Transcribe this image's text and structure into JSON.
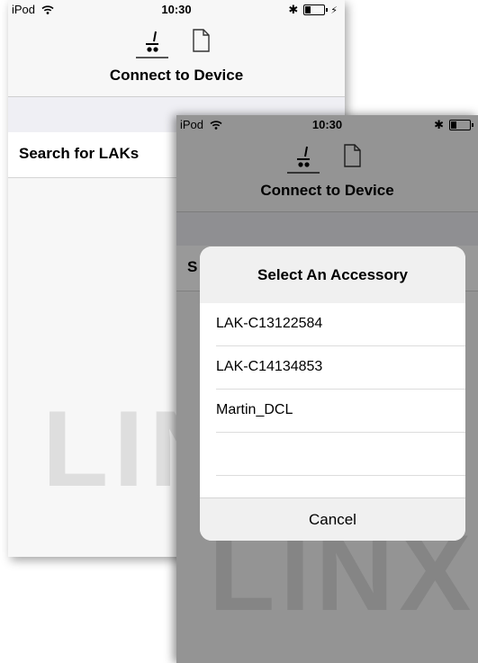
{
  "back_screen": {
    "status": {
      "carrier": "iPod",
      "time": "10:30"
    },
    "title": "Connect to Device",
    "row": "Search for LAKs",
    "watermark": "LINX"
  },
  "front_screen": {
    "status": {
      "carrier": "iPod",
      "time": "10:30"
    },
    "title": "Connect to Device",
    "row_partial": "S",
    "watermark": "LINX",
    "alert": {
      "title": "Select An Accessory",
      "items": [
        "LAK-C13122584",
        "LAK-C14134853",
        "Martin_DCL",
        "",
        ""
      ],
      "cancel": "Cancel"
    }
  }
}
